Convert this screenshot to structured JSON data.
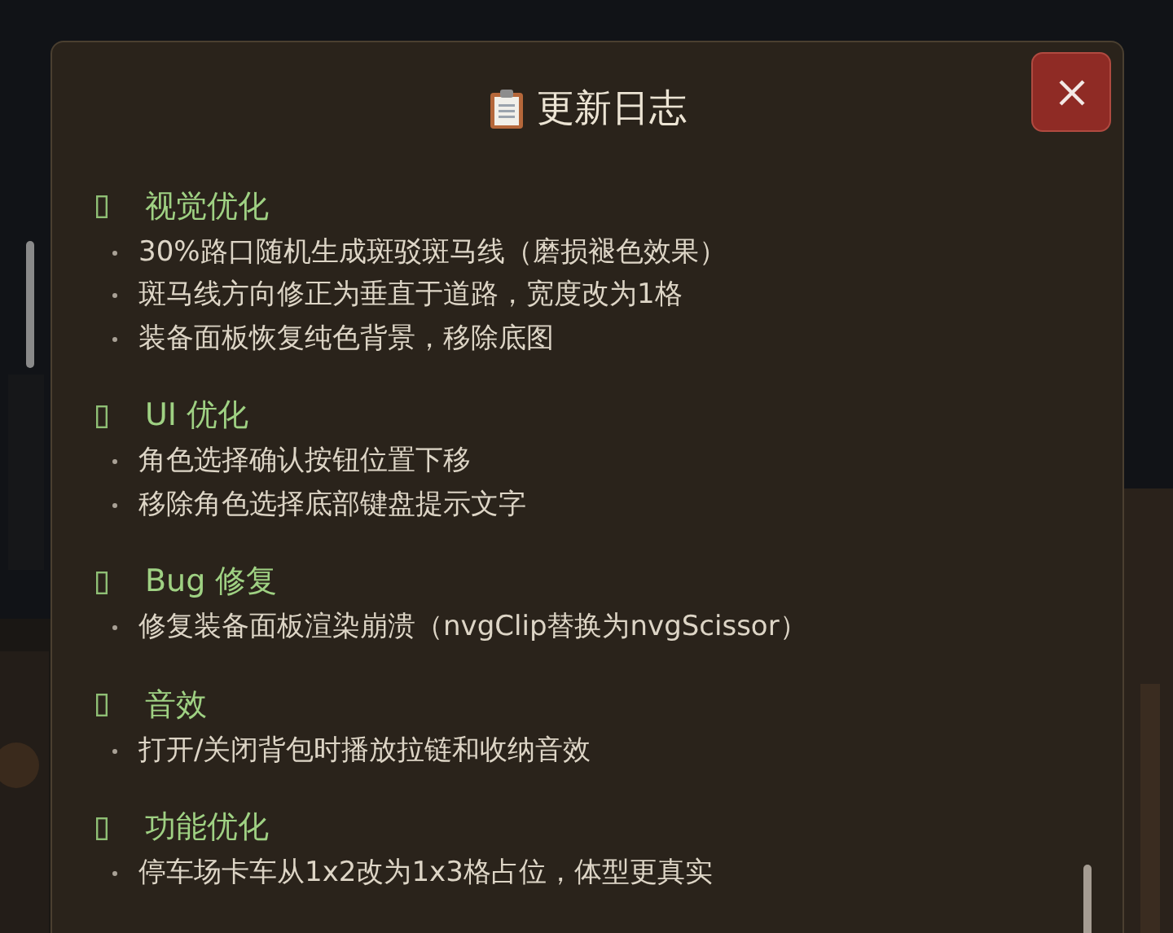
{
  "dialog": {
    "title": "更新日志",
    "sections": [
      {
        "heading": "视觉优化",
        "items": [
          "30%路口随机生成斑驳斑马线（磨损褪色效果）",
          "斑马线方向修正为垂直于道路，宽度改为1格",
          "装备面板恢复纯色背景，移除底图"
        ]
      },
      {
        "heading": "UI 优化",
        "items": [
          "角色选择确认按钮位置下移",
          "移除角色选择底部键盘提示文字"
        ]
      },
      {
        "heading": "Bug 修复",
        "items": [
          "修复装备面板渲染崩溃（nvgClip替换为nvgScissor）"
        ]
      },
      {
        "heading": "音效",
        "items": [
          "打开/关闭背包时播放拉链和收纳音效"
        ]
      },
      {
        "heading": "功能优化",
        "items": [
          "停车场卡车从1x2改为1x3格占位，体型更真实"
        ]
      }
    ]
  }
}
